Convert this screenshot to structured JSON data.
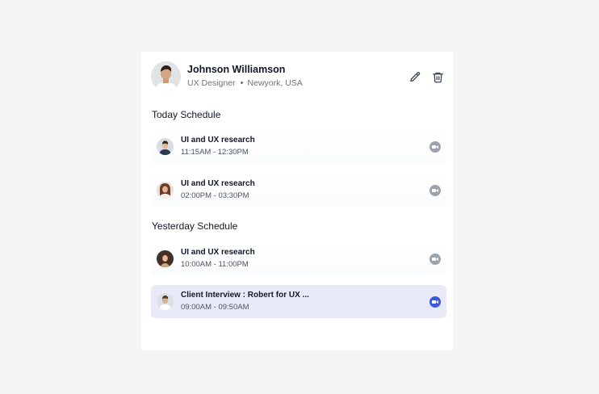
{
  "profile": {
    "name": "Johnson Williamson",
    "role": "UX Designer",
    "location": "Newyork, USA"
  },
  "sections": {
    "today": {
      "title": "Today Schedule",
      "items": [
        {
          "title": "UI and UX research",
          "time": "11:15AM - 12:30PM",
          "active": false
        },
        {
          "title": "UI and UX research",
          "time": "02:00PM - 03:30PM",
          "active": false
        }
      ]
    },
    "yesterday": {
      "title": "Yesterday Schedule",
      "items": [
        {
          "title": "UI and UX research",
          "time": "10:00AM - 11:00PM",
          "active": false
        },
        {
          "title": "Client Interview : Robert for UX ...",
          "time": "09:00AM - 09:50AM",
          "active": true
        }
      ]
    }
  },
  "icons": {
    "edit": "pencil-icon",
    "delete": "trash-icon",
    "video": "video-camera-icon"
  },
  "colors": {
    "background": "#f3f4f6",
    "card": "#ffffff",
    "active_item": "#e8ebf7",
    "accent": "#3b5bdb",
    "inactive_icon": "#9ca3af"
  }
}
